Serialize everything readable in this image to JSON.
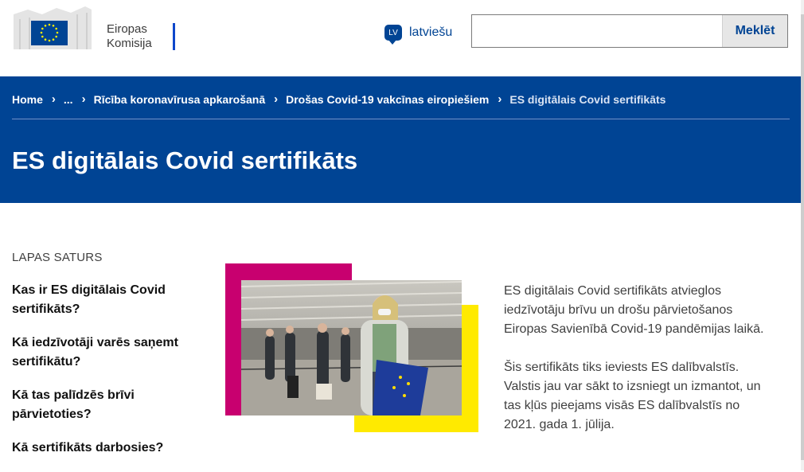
{
  "header": {
    "logo_line1": "Eiropas",
    "logo_line2": "Komisija",
    "language_code": "LV",
    "language_label": "latviešu",
    "search_placeholder": "",
    "search_button": "Meklēt"
  },
  "breadcrumb": [
    {
      "label": "Home"
    },
    {
      "label": "..."
    },
    {
      "label": "Rīcība koronavīrusa apkarošanā"
    },
    {
      "label": "Drošas Covid-19 vakcīnas eiropiešiem"
    },
    {
      "label": "ES digitālais Covid sertifikāts",
      "current": true
    }
  ],
  "page": {
    "title": "ES digitālais Covid sertifikāts"
  },
  "toc": {
    "title": "LAPAS SATURS",
    "items": [
      "Kas ir ES digitālais Covid sertifikāts?",
      "Kā iedzīvotāji varēs saņemt sertifikātu?",
      "Kā tas palīdzēs brīvi pārvietoties?",
      "Kā sertifikāts darbosies?"
    ]
  },
  "content": {
    "paragraphs": [
      "ES digitālais Covid sertifikāts atvieglos iedzīvotāju brīvu un drošu pārvietošanos Eiropas Savienībā Covid-19 pandēmijas laikā.",
      "Šis sertifikāts tiks ieviests ES dalībvalstīs. Valstis jau var sākt to izsniegt un izmantot, un tas kļūs pieejams visās ES dalībvalstīs no 2021. gada 1. jūlija."
    ]
  },
  "colors": {
    "brand_blue": "#004494",
    "accent_magenta": "#c8006f",
    "accent_yellow": "#ffea00"
  }
}
